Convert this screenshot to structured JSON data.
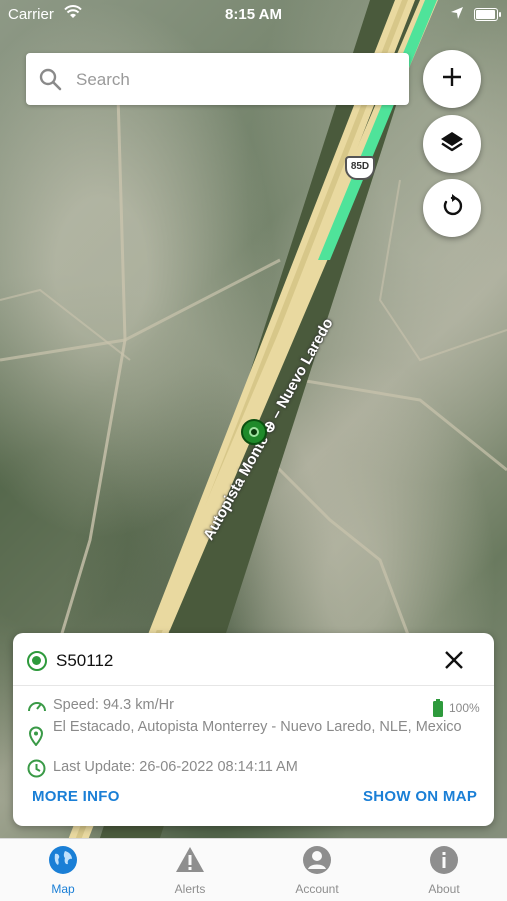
{
  "status_bar": {
    "carrier": "Carrier",
    "time": "8:15 AM"
  },
  "search": {
    "placeholder": "Search"
  },
  "map": {
    "road_label": "Autopista Monte ⊕ – Nuevo Laredo",
    "highway_shield": "85D",
    "colors": {
      "road": "#e9d9a0",
      "route": "#4fe39a",
      "marker": "#1f8a2a"
    }
  },
  "map_controls": [
    {
      "name": "add-button",
      "icon": "plus-icon"
    },
    {
      "name": "layers-button",
      "icon": "layers-icon"
    },
    {
      "name": "refresh-button",
      "icon": "refresh-icon"
    }
  ],
  "vehicle_card": {
    "vehicle_id": "S50112",
    "speed": "Speed: 94.3 km/Hr",
    "battery": "100%",
    "location": "El Estacado, Autopista Monterrey - Nuevo Laredo, NLE, Mexico",
    "last_update": "Last Update: 26-06-2022 08:14:11 AM",
    "more_info_label": "MORE INFO",
    "show_on_map_label": "SHOW ON MAP",
    "status_color": "#2e9a3c",
    "link_color": "#1a7fd6"
  },
  "tabbar": {
    "active": "Map",
    "tabs": [
      {
        "label": "Map",
        "icon": "globe-icon"
      },
      {
        "label": "Alerts",
        "icon": "warning-icon"
      },
      {
        "label": "Account",
        "icon": "person-icon"
      },
      {
        "label": "About",
        "icon": "info-icon"
      }
    ]
  }
}
